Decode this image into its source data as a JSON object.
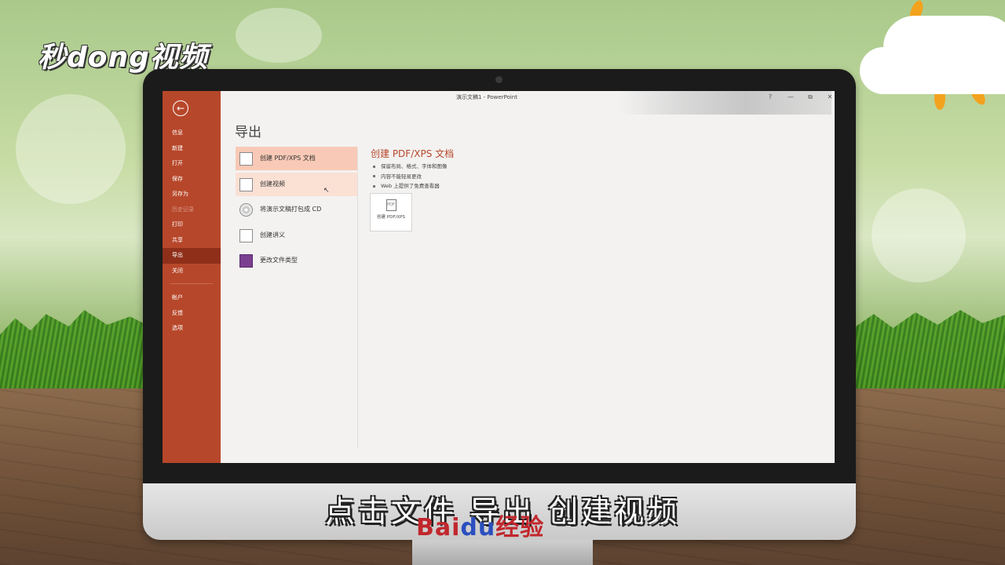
{
  "brand_logo": "秒dong视频",
  "window": {
    "title": "演示文稿1  -  PowerPoint",
    "controls": {
      "help": "?",
      "minimize": "—",
      "restore": "⧉",
      "close": "✕"
    }
  },
  "sidebar": {
    "back_symbol": "←",
    "items": [
      {
        "label": "信息"
      },
      {
        "label": "新建"
      },
      {
        "label": "打开"
      },
      {
        "label": "保存"
      },
      {
        "label": "另存为"
      },
      {
        "label": "历史记录"
      },
      {
        "label": "打印"
      },
      {
        "label": "共享"
      },
      {
        "label": "导出"
      },
      {
        "label": "关闭"
      }
    ],
    "bottom_items": [
      {
        "label": "帐户"
      },
      {
        "label": "反馈"
      },
      {
        "label": "选项"
      }
    ]
  },
  "main": {
    "page_title": "导出",
    "options": [
      {
        "label": "创建 PDF/XPS 文档"
      },
      {
        "label": "创建视频"
      },
      {
        "label": "将演示文稿打包成 CD"
      },
      {
        "label": "创建讲义"
      },
      {
        "label": "更改文件类型"
      }
    ],
    "detail": {
      "title": "创建 PDF/XPS 文档",
      "bullets": [
        "保留布局、格式、字体和图像",
        "内容不能轻易更改",
        "Web 上提供了免费查看器"
      ],
      "button_icon_text": "PDF",
      "button_label": "创建 PDF/XPS"
    }
  },
  "subtitle": "点击文件  导出  创建视频",
  "watermark": {
    "part1": "Bai",
    "part2": "du",
    "part3": "经验"
  },
  "colors": {
    "accent": "#b7472a",
    "selected": "#f8c9b6",
    "hover": "#fbe0d4"
  }
}
